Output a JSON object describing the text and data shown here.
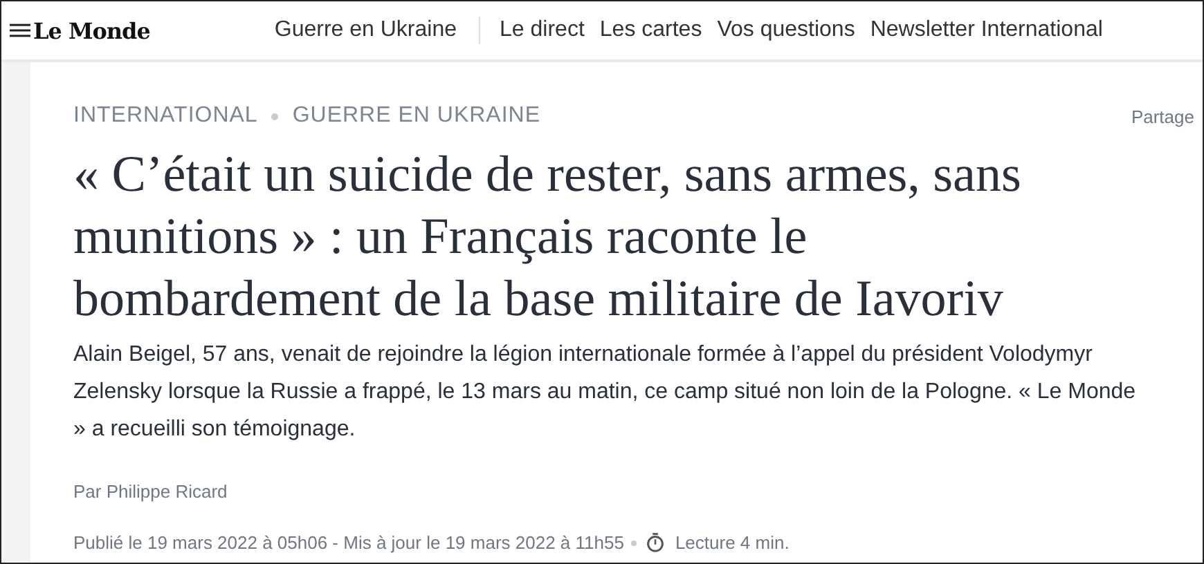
{
  "header": {
    "logo": "Le Monde",
    "nav": [
      {
        "label": "Guerre en Ukraine",
        "divider_after": true
      },
      {
        "label": "Le direct",
        "divider_after": false
      },
      {
        "label": "Les cartes",
        "divider_after": false
      },
      {
        "label": "Vos questions",
        "divider_after": false
      },
      {
        "label": "Newsletter International",
        "divider_after": false
      }
    ]
  },
  "article": {
    "breadcrumb": [
      "INTERNATIONAL",
      "GUERRE EN UKRAINE"
    ],
    "share": "Partage",
    "title": "« C’était un suicide de rester, sans armes, sans munitions » : un Français raconte le bombardement de la base militaire de Iavoriv",
    "summary": "Alain Beigel, 57 ans, venait de rejoindre la légion internationale formée à l’appel du président Volodymyr Zelensky lorsque la Russie a frappé, le 13 mars au matin, ce camp situé non loin de la Pologne. « Le Monde » a recueilli son témoignage.",
    "byline": "Par Philippe Ricard",
    "dates": "Publié le 19 mars 2022 à 05h06 - Mis à jour le 19 mars 2022 à 11h55",
    "reading_time": "Lecture 4 min."
  }
}
